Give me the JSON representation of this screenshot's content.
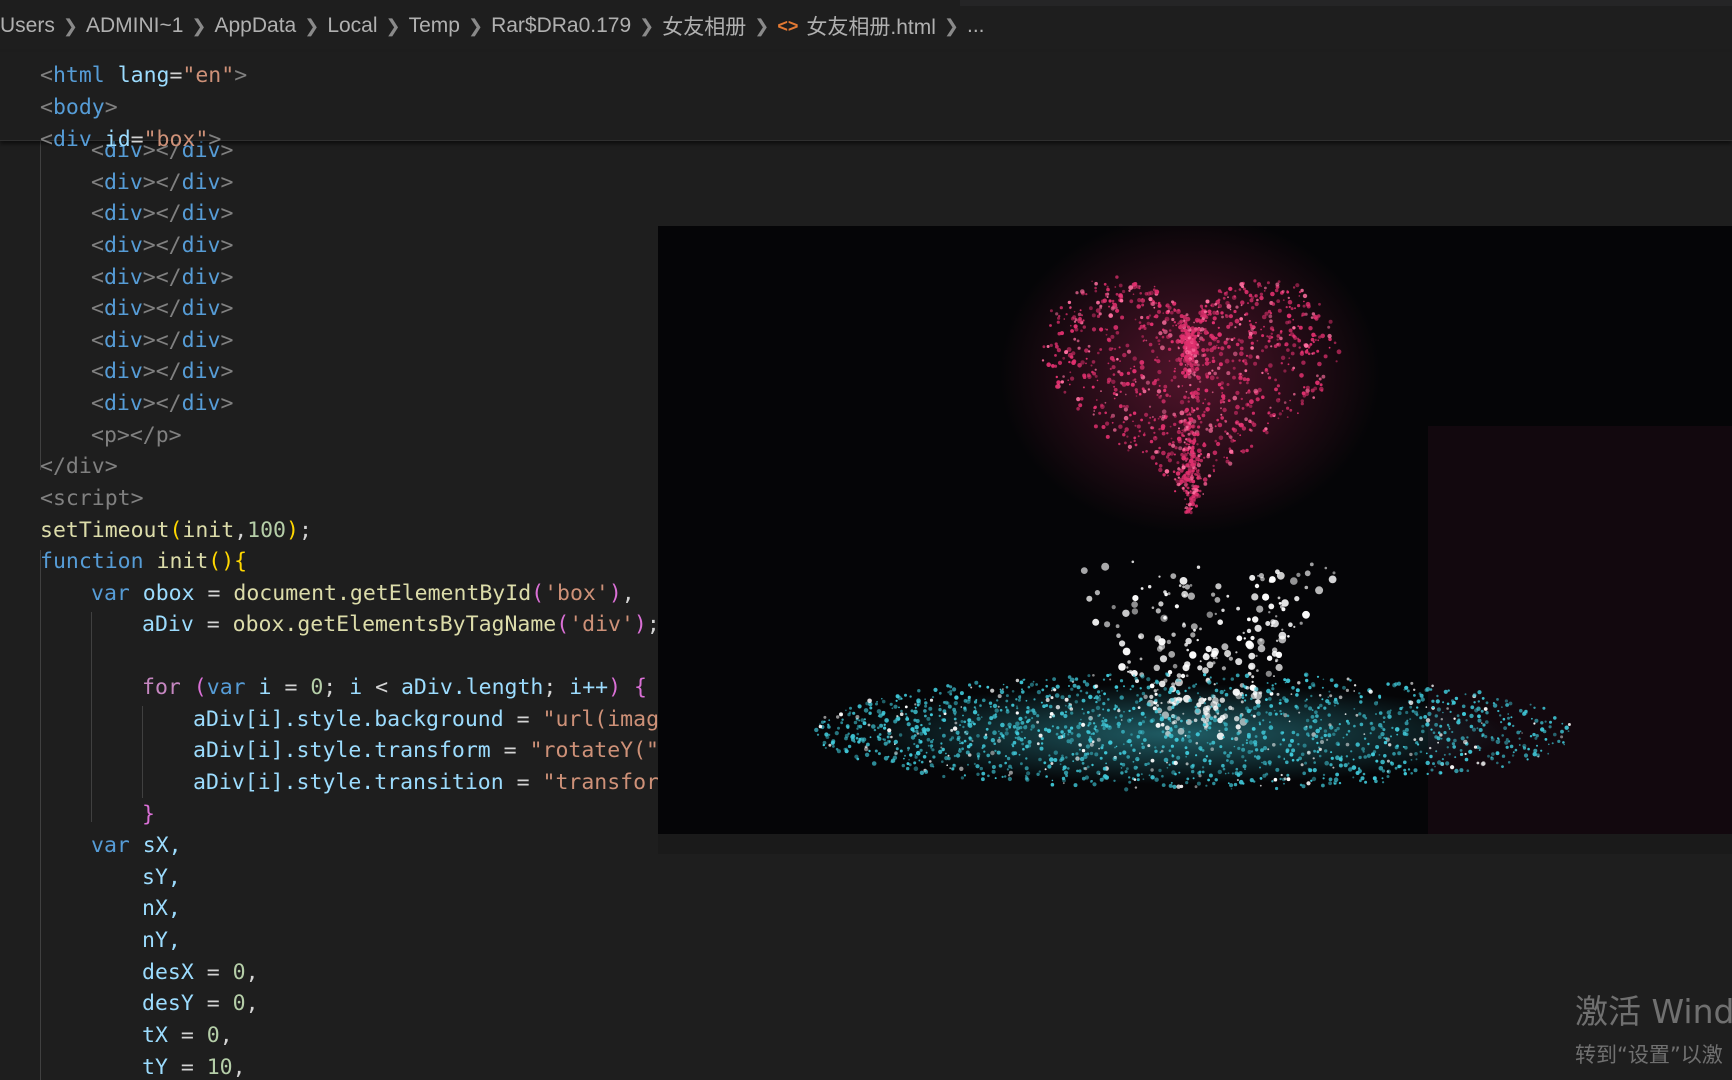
{
  "breadcrumb": {
    "segments": [
      "Users",
      "ADMINI~1",
      "AppData",
      "Local",
      "Temp",
      "Rar$DRa0.179",
      "女友相册"
    ],
    "file_icon": "<>",
    "file_name": "女友相册.html",
    "ellipsis": "..."
  },
  "code": {
    "sticky": [
      [
        "<",
        "html",
        " ",
        "lang",
        "=",
        "\"en\"",
        ">"
      ],
      [
        "<",
        "body",
        ">"
      ],
      [
        "<",
        "div",
        " ",
        "id",
        "=",
        "\"box\"",
        ">"
      ]
    ],
    "div_open": "<",
    "div_name": "div",
    "div_close_mid": "></",
    "div_end": ">",
    "p_line": "<p></p>",
    "div_close": "</div>",
    "script_open": "<script>",
    "settimeout_fn": "setTimeout",
    "settimeout_args": "init",
    "settimeout_num": "100",
    "function_kw": "function",
    "init_name": "init",
    "var_kw": "var",
    "obox": "obox",
    "getbyid": "document.getElementById",
    "box_str": "'box'",
    "adiv": "aDiv",
    "gettag": "obox.getElementsByTagName",
    "div_str": "'div'",
    "for_kw": "for",
    "i_var": "i",
    "adiv_length": "aDiv.length",
    "loop1": "aDiv[i].style.background",
    "loop1_val": "\"url(image",
    "loop2": "aDiv[i].style.transform",
    "loop2_val": "\"rotateY(\"-",
    "loop3": "aDiv[i].style.transition",
    "loop3_val": "\"transform",
    "vars": [
      "sX,",
      "sY,",
      "nX,",
      "nY,"
    ],
    "desX": "desX",
    "desY": "desY",
    "tX": "tX",
    "tY": "tY",
    "zero": "0",
    "ten": "10"
  },
  "watermark": {
    "line1": "激活 Wind",
    "line2": "转到“设置”以激"
  },
  "colors": {
    "heart": "#e0306e",
    "fountain": "#ffffff",
    "ring": "#40c8d8"
  }
}
